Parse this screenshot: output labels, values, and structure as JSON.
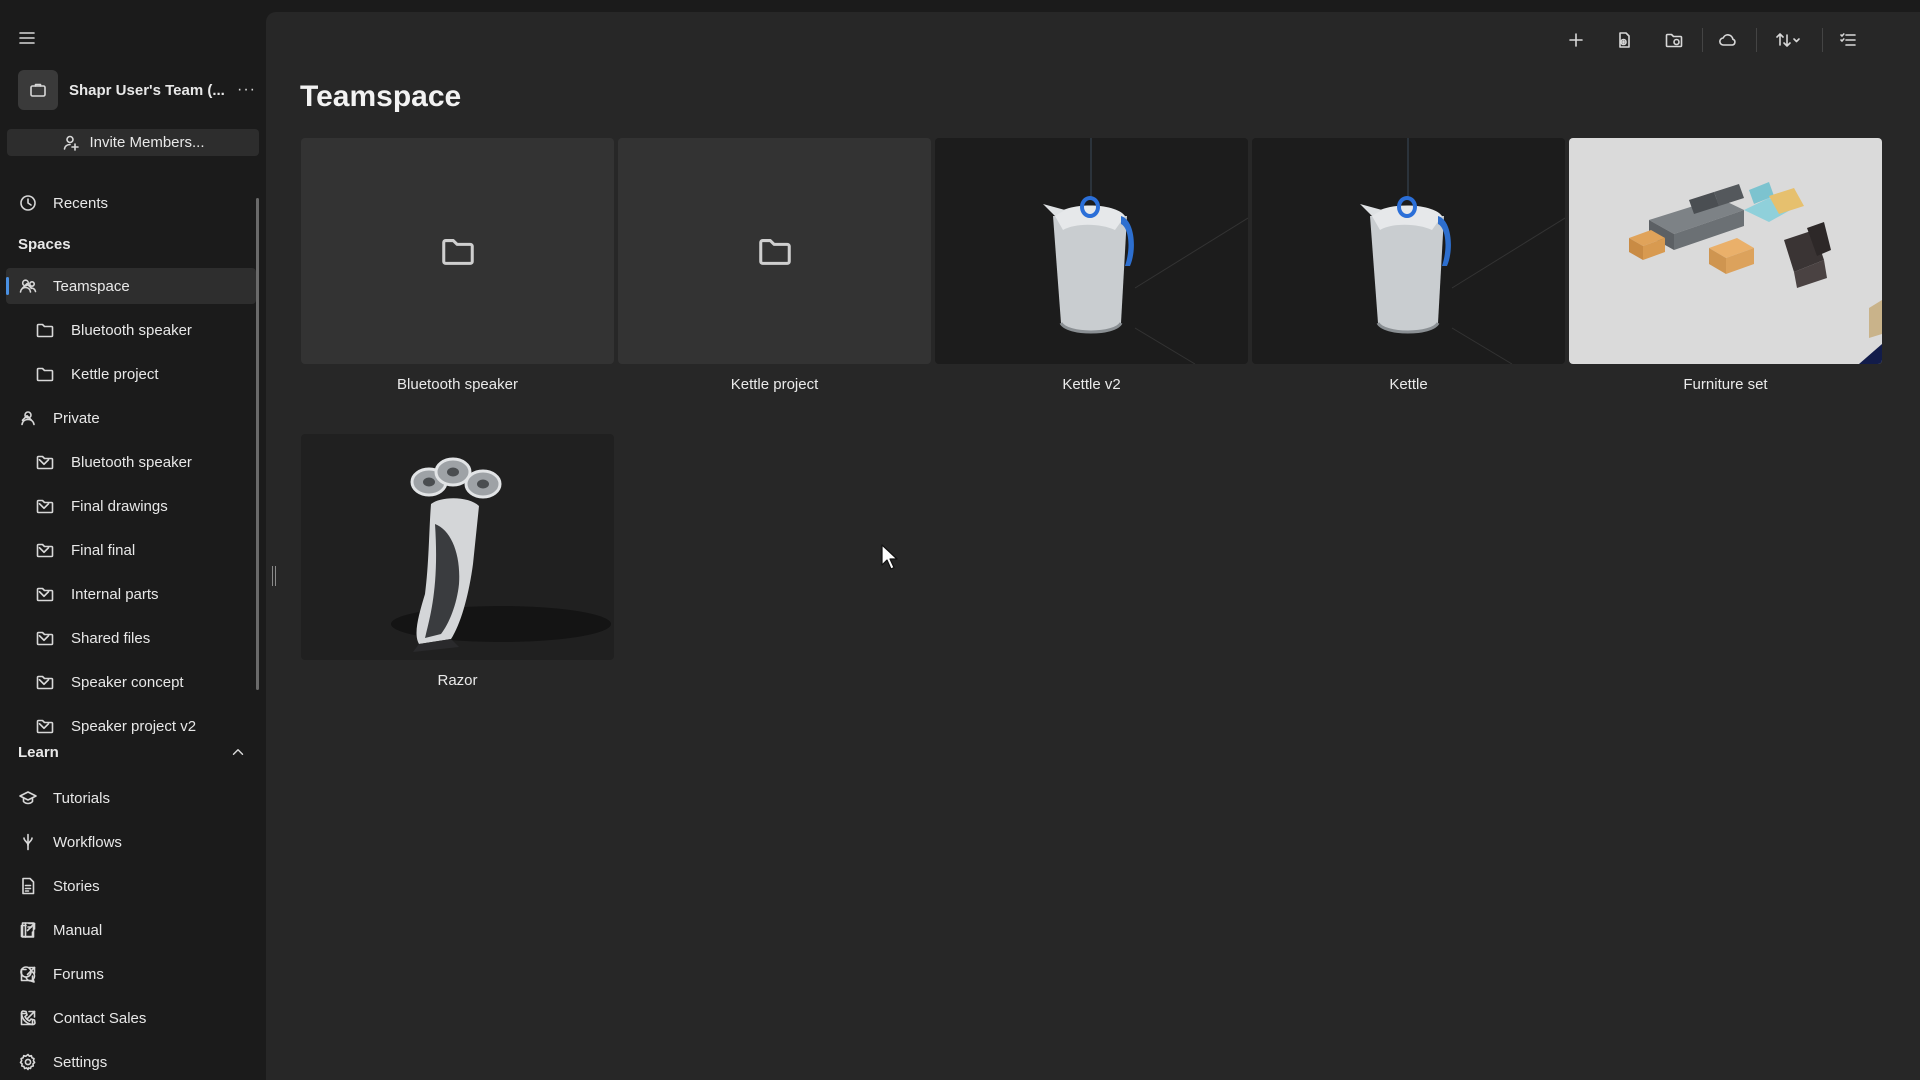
{
  "sidebar": {
    "team_name": "Shapr User's Team (...",
    "invite_label": "Invite Members...",
    "recents_label": "Recents",
    "spaces_header": "Spaces",
    "teamspace": {
      "label": "Teamspace",
      "children": [
        "Bluetooth speaker",
        "Kettle project"
      ]
    },
    "private": {
      "label": "Private",
      "children": [
        "Bluetooth speaker",
        "Final drawings",
        "Final final",
        "Internal parts",
        "Shared files",
        "Speaker concept",
        "Speaker project v2"
      ]
    },
    "learn_header": "Learn",
    "learn_items": [
      "Tutorials",
      "Workflows",
      "Stories"
    ],
    "external_items": [
      "Manual",
      "Forums",
      "Contact Sales"
    ],
    "settings_label": "Settings"
  },
  "main": {
    "title": "Teamspace",
    "items": [
      {
        "label": "Bluetooth speaker",
        "kind": "folder"
      },
      {
        "label": "Kettle project",
        "kind": "folder"
      },
      {
        "label": "Kettle v2",
        "kind": "design"
      },
      {
        "label": "Kettle",
        "kind": "design"
      },
      {
        "label": "Furniture set",
        "kind": "design"
      },
      {
        "label": "Razor",
        "kind": "design"
      }
    ]
  },
  "toolbar": {
    "icons": [
      "add-icon",
      "import-file-icon",
      "new-folder-icon",
      "cloud-icon",
      "sort-icon",
      "list-view-icon"
    ]
  },
  "colors": {
    "sidebar_bg": "#1b1b1b",
    "main_bg": "#272727",
    "accent": "#4a90e2"
  }
}
